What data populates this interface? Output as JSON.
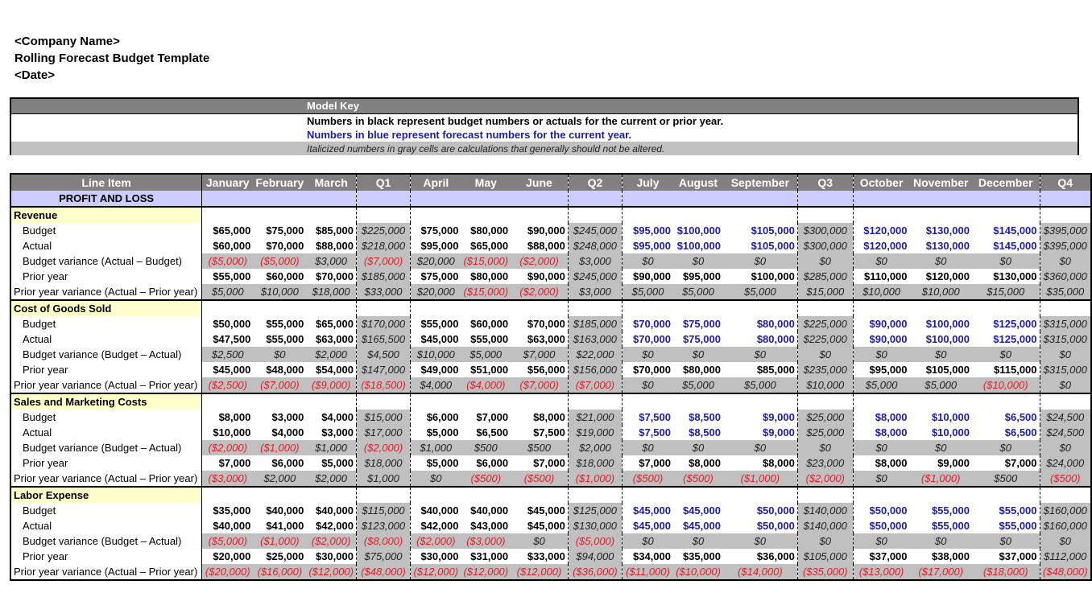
{
  "header": {
    "company": "<Company Name>",
    "title": "Rolling Forecast Budget Template",
    "date": "<Date>"
  },
  "model_key": {
    "title": "Model Key",
    "black_note": "Numbers in black represent budget numbers or actuals for the current or prior year.",
    "blue_note": "Numbers in blue represent forecast numbers for the current year.",
    "gray_note": "Italicized numbers in gray cells are calculations that generally should not be altered.",
    "colors": {
      "forecast_blue": "#1d1da8",
      "negative_red": "#e0202a",
      "calc_gray": "#c0c0c0",
      "header_gray": "#808080",
      "section_yellow": "#ffffcc",
      "pl_lavender": "#ccccff"
    }
  },
  "table": {
    "columns": [
      "Line Item",
      "January",
      "February",
      "March",
      "Q1",
      "April",
      "May",
      "June",
      "Q2",
      "July",
      "August",
      "September",
      "Q3",
      "October",
      "November",
      "December",
      "Q4"
    ],
    "pl_label": "PROFIT AND LOSS",
    "sections": [
      {
        "name": "Revenue",
        "rows": [
          {
            "label": "Budget",
            "values": [
              "$65,000",
              "$75,000",
              "$85,000",
              "$225,000",
              "$75,000",
              "$80,000",
              "$90,000",
              "$245,000",
              "$95,000",
              "$100,000",
              "$105,000",
              "$300,000",
              "$120,000",
              "$130,000",
              "$145,000",
              "$395,000"
            ]
          },
          {
            "label": "Actual",
            "values": [
              "$60,000",
              "$70,000",
              "$88,000",
              "$218,000",
              "$95,000",
              "$65,000",
              "$88,000",
              "$248,000",
              "$95,000",
              "$100,000",
              "$105,000",
              "$300,000",
              "$120,000",
              "$130,000",
              "$145,000",
              "$395,000"
            ]
          },
          {
            "label": "Budget variance (Actual – Budget)",
            "values": [
              "($5,000)",
              "($5,000)",
              "$3,000",
              "($7,000)",
              "$20,000",
              "($15,000)",
              "($2,000)",
              "$3,000",
              "$0",
              "$0",
              "$0",
              "$0",
              "$0",
              "$0",
              "$0",
              "$0"
            ]
          },
          {
            "label": "Prior year",
            "values": [
              "$55,000",
              "$60,000",
              "$70,000",
              "$185,000",
              "$75,000",
              "$80,000",
              "$90,000",
              "$245,000",
              "$90,000",
              "$95,000",
              "$100,000",
              "$285,000",
              "$110,000",
              "$120,000",
              "$130,000",
              "$360,000"
            ]
          },
          {
            "label": "Prior year variance (Actual – Prior year)",
            "values": [
              "$5,000",
              "$10,000",
              "$18,000",
              "$33,000",
              "$20,000",
              "($15,000)",
              "($2,000)",
              "$3,000",
              "$5,000",
              "$5,000",
              "$5,000",
              "$15,000",
              "$10,000",
              "$10,000",
              "$15,000",
              "$35,000"
            ]
          }
        ]
      },
      {
        "name": "Cost of Goods Sold",
        "rows": [
          {
            "label": "Budget",
            "values": [
              "$50,000",
              "$55,000",
              "$65,000",
              "$170,000",
              "$55,000",
              "$60,000",
              "$70,000",
              "$185,000",
              "$70,000",
              "$75,000",
              "$80,000",
              "$225,000",
              "$90,000",
              "$100,000",
              "$125,000",
              "$315,000"
            ]
          },
          {
            "label": "Actual",
            "values": [
              "$47,500",
              "$55,000",
              "$63,000",
              "$165,500",
              "$45,000",
              "$55,000",
              "$63,000",
              "$163,000",
              "$70,000",
              "$75,000",
              "$80,000",
              "$225,000",
              "$90,000",
              "$100,000",
              "$125,000",
              "$315,000"
            ]
          },
          {
            "label": "Budget variance (Budget – Actual)",
            "values": [
              "$2,500",
              "$0",
              "$2,000",
              "$4,500",
              "$10,000",
              "$5,000",
              "$7,000",
              "$22,000",
              "$0",
              "$0",
              "$0",
              "$0",
              "$0",
              "$0",
              "$0",
              "$0"
            ]
          },
          {
            "label": "Prior year",
            "values": [
              "$45,000",
              "$48,000",
              "$54,000",
              "$147,000",
              "$49,000",
              "$51,000",
              "$56,000",
              "$156,000",
              "$70,000",
              "$80,000",
              "$85,000",
              "$235,000",
              "$95,000",
              "$105,000",
              "$115,000",
              "$315,000"
            ]
          },
          {
            "label": "Prior year variance (Actual – Prior year)",
            "values": [
              "($2,500)",
              "($7,000)",
              "($9,000)",
              "($18,500)",
              "$4,000",
              "($4,000)",
              "($7,000)",
              "($7,000)",
              "$0",
              "$5,000",
              "$5,000",
              "$10,000",
              "$5,000",
              "$5,000",
              "($10,000)",
              "$0"
            ]
          }
        ]
      },
      {
        "name": "Sales and Marketing Costs",
        "rows": [
          {
            "label": "Budget",
            "values": [
              "$8,000",
              "$3,000",
              "$4,000",
              "$15,000",
              "$6,000",
              "$7,000",
              "$8,000",
              "$21,000",
              "$7,500",
              "$8,500",
              "$9,000",
              "$25,000",
              "$8,000",
              "$10,000",
              "$6,500",
              "$24,500"
            ]
          },
          {
            "label": "Actual",
            "values": [
              "$10,000",
              "$4,000",
              "$3,000",
              "$17,000",
              "$5,000",
              "$6,500",
              "$7,500",
              "$19,000",
              "$7,500",
              "$8,500",
              "$9,000",
              "$25,000",
              "$8,000",
              "$10,000",
              "$6,500",
              "$24,500"
            ]
          },
          {
            "label": "Budget variance (Budget – Actual)",
            "values": [
              "($2,000)",
              "($1,000)",
              "$1,000",
              "($2,000)",
              "$1,000",
              "$500",
              "$500",
              "$2,000",
              "$0",
              "$0",
              "$0",
              "$0",
              "$0",
              "$0",
              "$0",
              "$0"
            ]
          },
          {
            "label": "Prior year",
            "values": [
              "$7,000",
              "$6,000",
              "$5,000",
              "$18,000",
              "$5,000",
              "$6,000",
              "$7,000",
              "$18,000",
              "$7,000",
              "$8,000",
              "$8,000",
              "$23,000",
              "$8,000",
              "$9,000",
              "$7,000",
              "$24,000"
            ]
          },
          {
            "label": "Prior year variance (Actual – Prior year)",
            "values": [
              "($3,000)",
              "$2,000",
              "$2,000",
              "$1,000",
              "$0",
              "($500)",
              "($500)",
              "($1,000)",
              "($500)",
              "($500)",
              "($1,000)",
              "($2,000)",
              "$0",
              "($1,000)",
              "$500",
              "($500)"
            ]
          }
        ]
      },
      {
        "name": "Labor Expense",
        "rows": [
          {
            "label": "Budget",
            "values": [
              "$35,000",
              "$40,000",
              "$40,000",
              "$115,000",
              "$40,000",
              "$40,000",
              "$45,000",
              "$125,000",
              "$45,000",
              "$45,000",
              "$50,000",
              "$140,000",
              "$50,000",
              "$55,000",
              "$55,000",
              "$160,000"
            ]
          },
          {
            "label": "Actual",
            "values": [
              "$40,000",
              "$41,000",
              "$42,000",
              "$123,000",
              "$42,000",
              "$43,000",
              "$45,000",
              "$130,000",
              "$45,000",
              "$45,000",
              "$50,000",
              "$140,000",
              "$50,000",
              "$55,000",
              "$55,000",
              "$160,000"
            ]
          },
          {
            "label": "Budget variance (Budget – Actual)",
            "values": [
              "($5,000)",
              "($1,000)",
              "($2,000)",
              "($8,000)",
              "($2,000)",
              "($3,000)",
              "$0",
              "($5,000)",
              "$0",
              "$0",
              "$0",
              "$0",
              "$0",
              "$0",
              "$0",
              "$0"
            ]
          },
          {
            "label": "Prior year",
            "values": [
              "$20,000",
              "$25,000",
              "$30,000",
              "$75,000",
              "$30,000",
              "$31,000",
              "$33,000",
              "$94,000",
              "$34,000",
              "$35,000",
              "$36,000",
              "$105,000",
              "$37,000",
              "$38,000",
              "$37,000",
              "$112,000"
            ]
          },
          {
            "label": "Prior year variance (Actual – Prior year)",
            "values": [
              "($20,000)",
              "($16,000)",
              "($12,000)",
              "($48,000)",
              "($12,000)",
              "($12,000)",
              "($12,000)",
              "($36,000)",
              "($11,000)",
              "($10,000)",
              "($14,000)",
              "($35,000)",
              "($13,000)",
              "($17,000)",
              "($18,000)",
              "($48,000)"
            ]
          }
        ]
      }
    ]
  }
}
